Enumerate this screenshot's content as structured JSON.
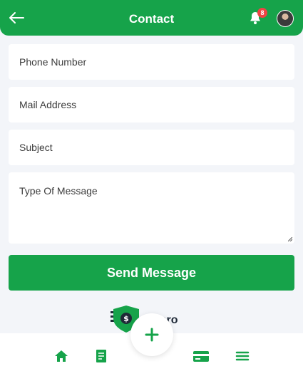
{
  "header": {
    "title": "Contact",
    "notification_count": "8"
  },
  "form": {
    "phone_placeholder": "Phone Number",
    "mail_placeholder": "Mail Address",
    "subject_placeholder": "Subject",
    "message_placeholder": "Type Of Message",
    "send_label": "Send Message"
  },
  "brand": {
    "text": "itpro"
  },
  "colors": {
    "primary": "#16a34a",
    "badge": "#ef4444",
    "background": "#f3f5f9"
  },
  "icons": {
    "back": "arrow-left-icon",
    "bell": "bell-icon",
    "home": "home-icon",
    "document": "document-icon",
    "add": "plus-icon",
    "card": "credit-card-icon",
    "menu": "menu-icon"
  }
}
